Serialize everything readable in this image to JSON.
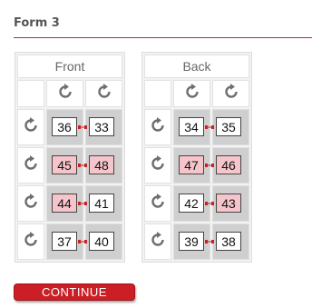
{
  "form": {
    "title": "Form 3",
    "continue_label": "CONTINUE"
  },
  "panels": [
    {
      "label": "Front",
      "rows": [
        {
          "left": "36",
          "right": "33",
          "highlighted": false
        },
        {
          "left": "45",
          "right": "48",
          "highlighted": true
        },
        {
          "left": "44",
          "right": "41",
          "highlighted": "left"
        },
        {
          "left": "37",
          "right": "40",
          "highlighted": false
        }
      ]
    },
    {
      "label": "Back",
      "rows": [
        {
          "left": "34",
          "right": "35",
          "highlighted": false
        },
        {
          "left": "47",
          "right": "46",
          "highlighted": true
        },
        {
          "left": "42",
          "right": "43",
          "highlighted": "right"
        },
        {
          "left": "39",
          "right": "38",
          "highlighted": false
        }
      ]
    }
  ],
  "colors": {
    "accent": "#c8262d",
    "highlight": "#f6c5cb",
    "cell_gray": "#cfcfcf"
  },
  "icons": {
    "rotate": "rotate-clockwise-icon"
  }
}
